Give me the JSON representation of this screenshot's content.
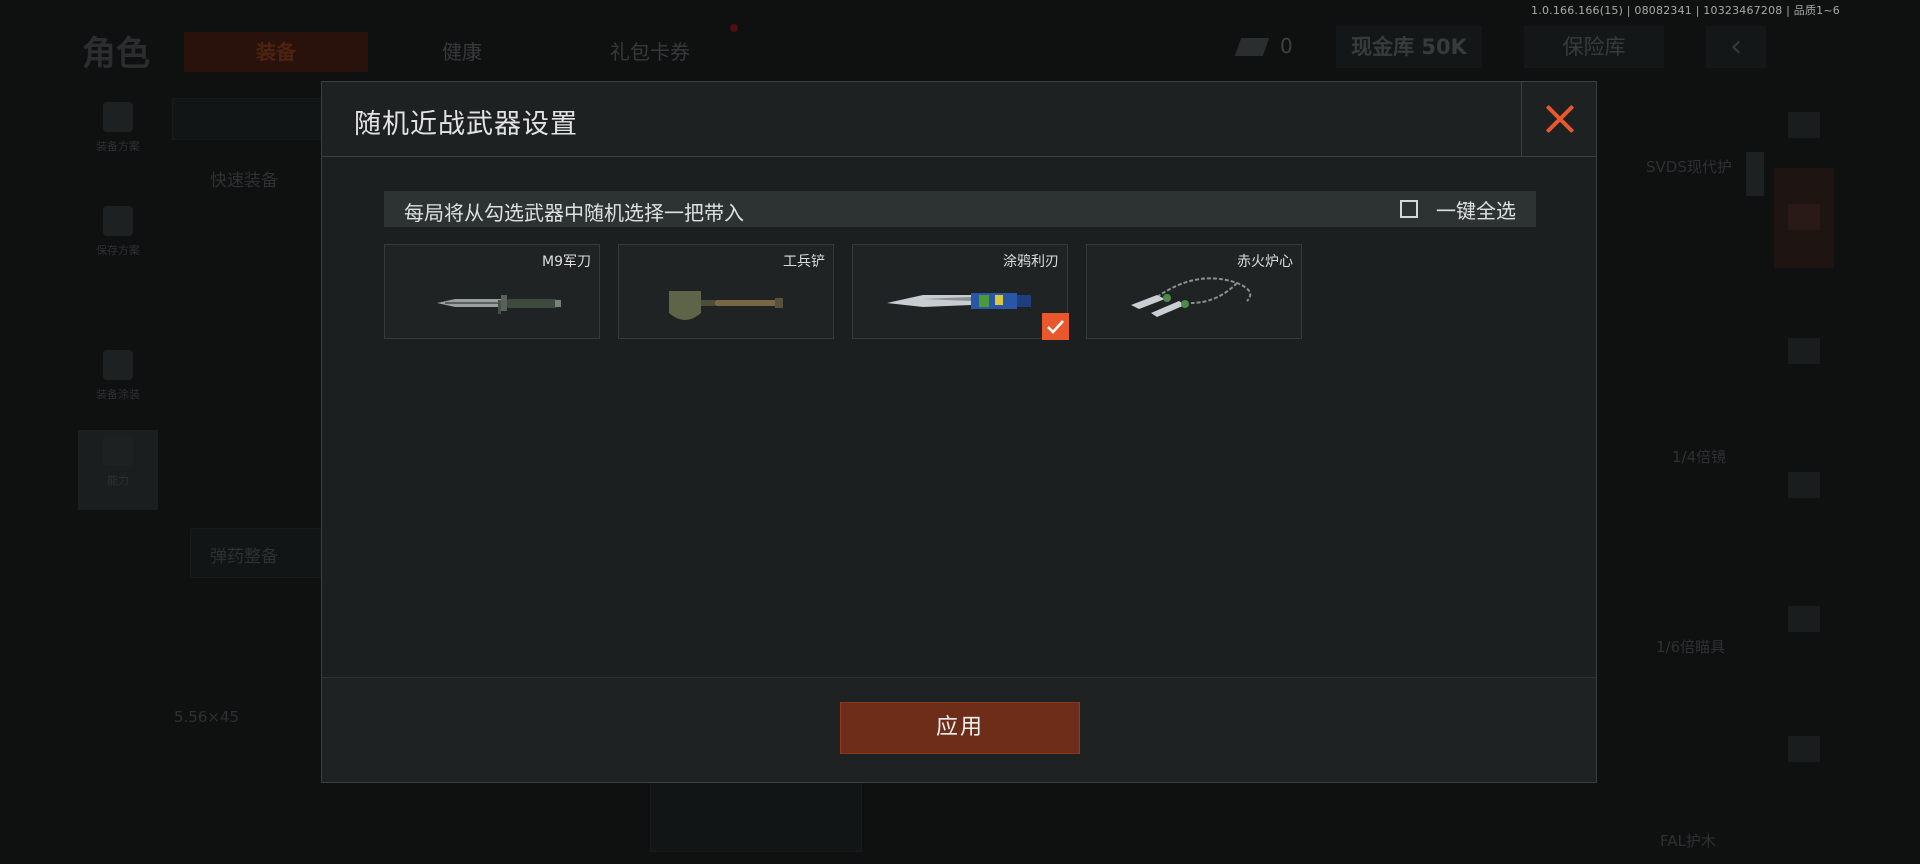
{
  "version_info": "1.0.166.166(15) | 08082341 | 10323467208 | 品质1~6",
  "background": {
    "page_title": "角色",
    "tabs": [
      {
        "label": "装备"
      },
      {
        "label": "健康"
      },
      {
        "label": "礼包卡券"
      }
    ],
    "currency_value": "0",
    "cash_vault_label": "现金库 50K",
    "safe_box_label": "保险库",
    "back_glyph": "‹",
    "sidebar": [
      {
        "label": "装备方案"
      },
      {
        "label": "保存方案"
      },
      {
        "label": "装备涂装"
      },
      {
        "label": "能力"
      }
    ],
    "quick_equip_label": "快速装备",
    "ammo_label": "弹药整备",
    "caliber_label": "5.56×45",
    "right_labels": [
      "SVDS现代护",
      "1/4倍镜",
      "1/6倍瞄具",
      "FAL护木"
    ]
  },
  "modal": {
    "title": "随机近战武器设置",
    "info_text": "每局将从勾选武器中随机选择一把带入",
    "select_all_label": "一键全选",
    "weapons": [
      {
        "name": "M9军刀",
        "checked": false
      },
      {
        "name": "工兵铲",
        "checked": false
      },
      {
        "name": "涂鸦利刃",
        "checked": true
      },
      {
        "name": "赤火炉心",
        "checked": false
      }
    ],
    "apply_label": "应用"
  },
  "colors": {
    "accent": "#e9582d",
    "apply_button": "#6e2d19"
  }
}
